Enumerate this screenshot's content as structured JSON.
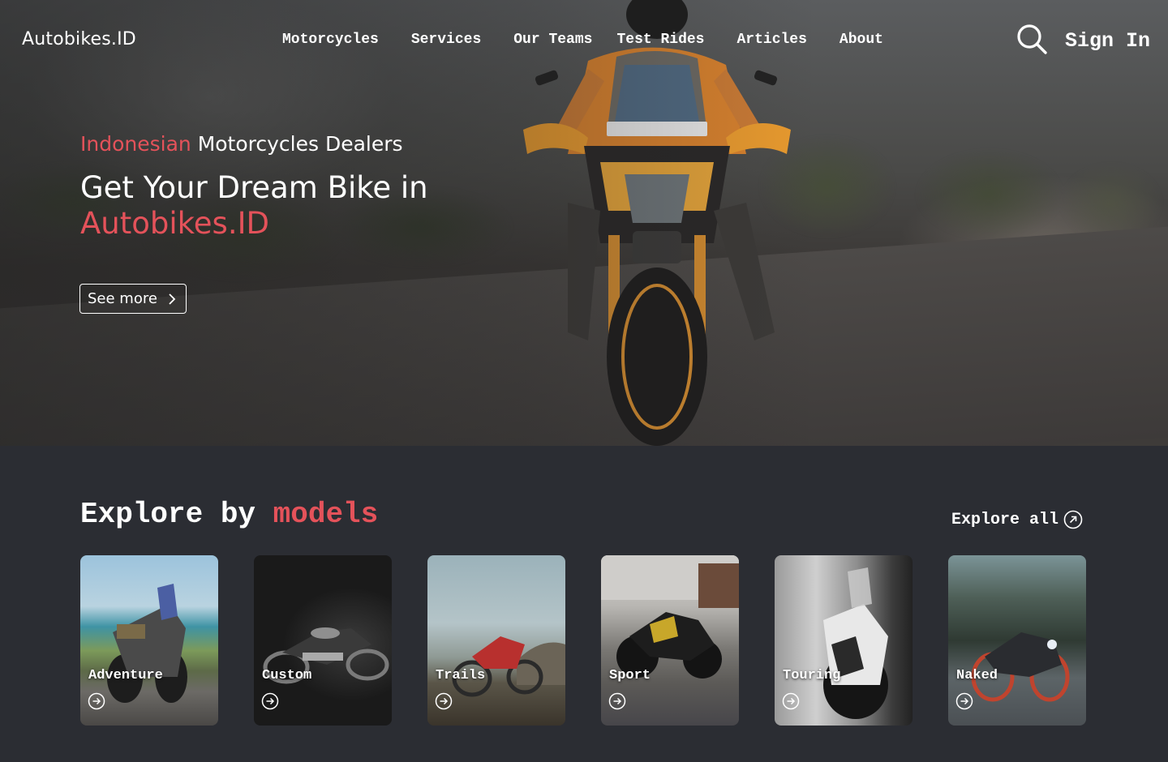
{
  "nav": {
    "logo": "Autobikes.ID",
    "items": [
      {
        "label": "Motorcycles"
      },
      {
        "label": "Services"
      },
      {
        "label": "Our Teams"
      },
      {
        "label": "Test Rides"
      },
      {
        "label": "Articles"
      },
      {
        "label": "About"
      }
    ],
    "search_icon": "search-icon",
    "sign_in": "Sign In"
  },
  "hero": {
    "subtitle_highlight": "Indonesian",
    "subtitle_rest": " Motorcycles Dealers",
    "headline_line1": "Get Your Dream Bike in",
    "headline_highlight": "Autobikes.ID",
    "cta_label": "See more",
    "cta_icon": "chevron-right-icon"
  },
  "explore": {
    "title_prefix": "Explore by ",
    "title_highlight": "models",
    "explore_all_label": "Explore all",
    "explore_all_icon": "arrow-up-right-circle-icon",
    "models": [
      {
        "label": "Adventure"
      },
      {
        "label": "Custom"
      },
      {
        "label": "Trails"
      },
      {
        "label": "Sport"
      },
      {
        "label": "Touring"
      },
      {
        "label": "Naked"
      }
    ],
    "card_icon": "arrow-right-circle-icon"
  },
  "colors": {
    "accent": "#e4525a",
    "background": "#2b2d33",
    "text": "#ffffff"
  }
}
